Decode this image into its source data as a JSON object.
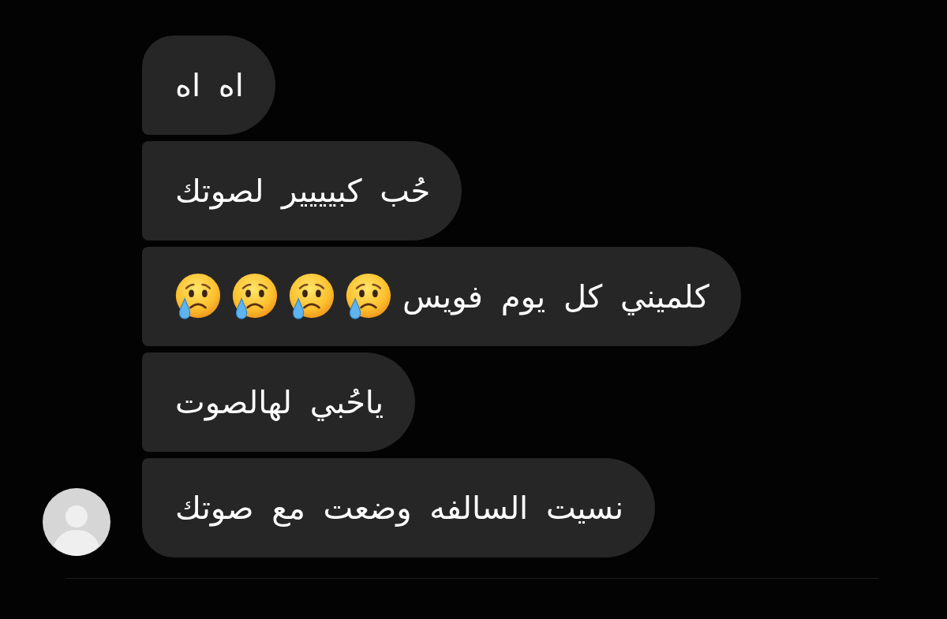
{
  "messages": [
    {
      "content": [
        {
          "kind": "text",
          "text": "اه اه"
        }
      ]
    },
    {
      "content": [
        {
          "kind": "text",
          "text": "حُب كبيييير لصوتك"
        }
      ]
    },
    {
      "content": [
        {
          "kind": "text",
          "text": "كلميني كل يوم فويس"
        },
        {
          "kind": "emoji"
        },
        {
          "kind": "emoji"
        },
        {
          "kind": "emoji"
        },
        {
          "kind": "emoji"
        }
      ]
    },
    {
      "content": [
        {
          "kind": "text",
          "text": "ياحُبي لهالصوت"
        }
      ]
    },
    {
      "content": [
        {
          "kind": "text",
          "text": "نسيت السالفه وضعت مع صوتك"
        }
      ]
    }
  ]
}
